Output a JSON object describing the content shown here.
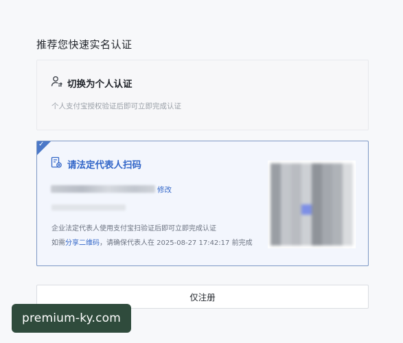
{
  "page_title": "推荐您快速实名认证",
  "personal_card": {
    "title": "切换为个人认证",
    "description": "个人支付宝授权验证后即可立即完成认证",
    "icon": "user-switch-icon"
  },
  "legal_card": {
    "title": "请法定代表人扫码",
    "icon": "scan-doc-icon",
    "edit_label": "修改",
    "description": "企业法定代表人使用支付宝扫验证后即可立即完成认证",
    "note_prefix": "如需",
    "share_label": "分享二维码",
    "note_suffix": "，请确保代表人在 2025-08-27 17:42:17 前完成",
    "accent_color": "#3266c8"
  },
  "register_button": {
    "label": "仅注册"
  },
  "watermark": {
    "text": "premium-ky.com"
  }
}
